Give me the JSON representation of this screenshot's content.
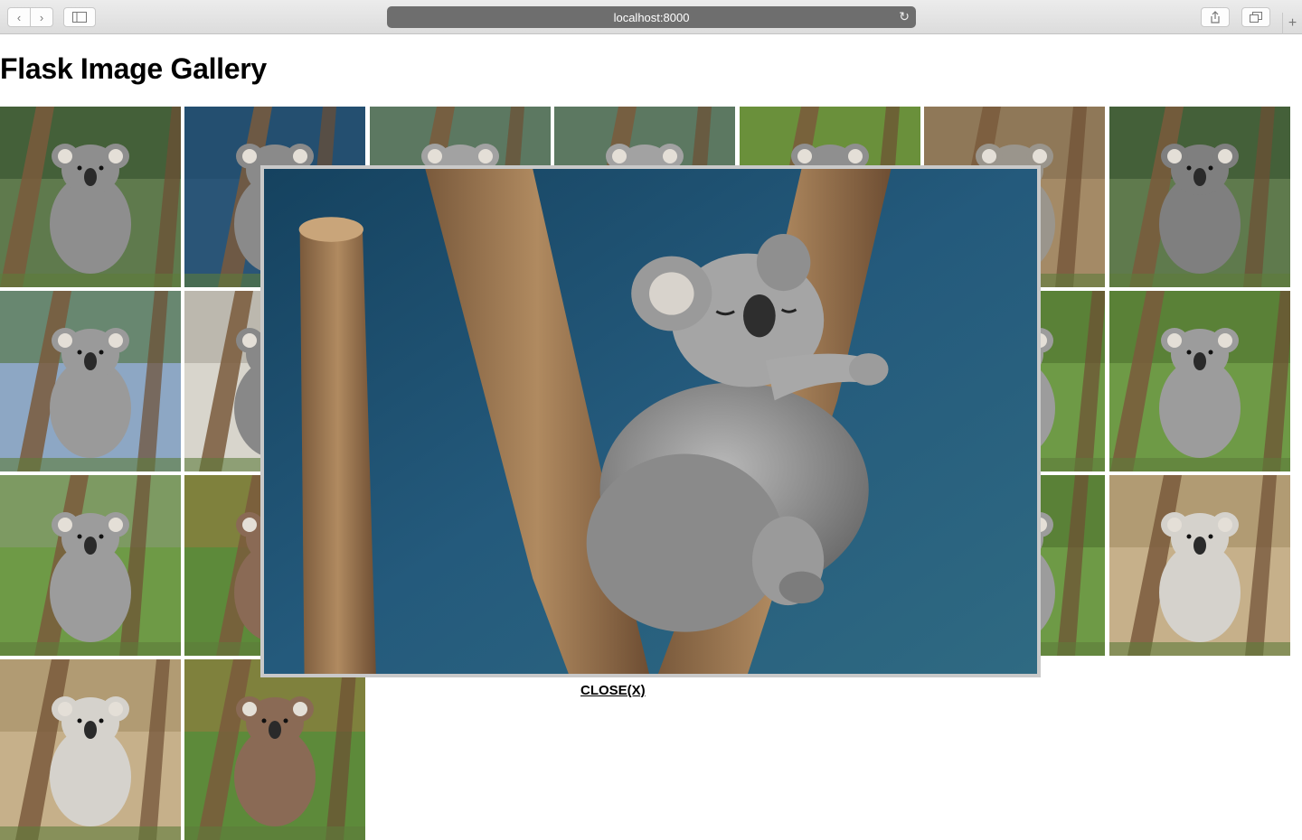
{
  "browser": {
    "url": "localhost:8000"
  },
  "page": {
    "title": "Flask Image Gallery"
  },
  "lightbox": {
    "close_label": "CLOSE(X)"
  },
  "gallery": {
    "thumbnails": [
      {
        "bg": "#5f7a4d",
        "fur": "#8e8e8e",
        "sky": "#2d4a2a"
      },
      {
        "bg": "#2a5577",
        "fur": "#8a8a8a",
        "sky": "#1f4a6b"
      },
      {
        "bg": "#6d8a70",
        "fur": "#a2a2a2",
        "sky": "#4f6a55"
      },
      {
        "bg": "#6d8a70",
        "fur": "#a2a2a2",
        "sky": "#4f6a55"
      },
      {
        "bg": "#7ea64a",
        "fur": "#8f8f8f",
        "sky": "#5a7d2f"
      },
      {
        "bg": "#a48a66",
        "fur": "#9a958c",
        "sky": "#7e6a4c"
      },
      {
        "bg": "#5f7a4d",
        "fur": "#7f7f7f",
        "sky": "#2d4a2a"
      },
      {
        "bg": "#8da7c4",
        "fur": "#9a9a9a",
        "sky": "#4a6d2c"
      },
      {
        "bg": "#d8d5cc",
        "fur": "#888",
        "sky": "#a5a096"
      },
      {
        "bg": "#5d7d3e",
        "fur": "#9a9a9a",
        "sky": "#a39a8a"
      },
      {
        "bg": "#b8a894",
        "fur": "#7a7a7a",
        "sky": "#cfc5b5"
      },
      {
        "bg": "#a1835e",
        "fur": "#9c9c9c",
        "sky": "#7a6146"
      },
      {
        "bg": "#6e9a46",
        "fur": "#9c9c9c",
        "sky": "#4a6d2c"
      },
      {
        "bg": "#6e9a46",
        "fur": "#9c9c9c",
        "sky": "#4a6d2c"
      },
      {
        "bg": "#6e9a46",
        "fur": "#9c9c9c",
        "sky": "#8a9a7a"
      },
      {
        "bg": "#5d8a3a",
        "fur": "#8a6a55",
        "sky": "#9a7a40"
      },
      {
        "bg": "#b28a5a",
        "fur": "#5e4a3e",
        "sky": "#7a5a3a"
      },
      {
        "bg": "#6e9a46",
        "fur": "#9c9c9c",
        "sky": "#4a6d2c"
      },
      {
        "bg": "#a1835e",
        "fur": "#9c9c9c",
        "sky": "#7a6146"
      },
      {
        "bg": "#6e9a46",
        "fur": "#9c9c9c",
        "sky": "#4a6d2c"
      },
      {
        "bg": "#c6b08a",
        "fur": "#d5d2cc",
        "sky": "#a08a60"
      },
      {
        "bg": "#c6b08a",
        "fur": "#d5d2cc",
        "sky": "#a08a60"
      },
      {
        "bg": "#5d8a3a",
        "fur": "#8a6a55",
        "sky": "#9a7a40"
      }
    ]
  }
}
